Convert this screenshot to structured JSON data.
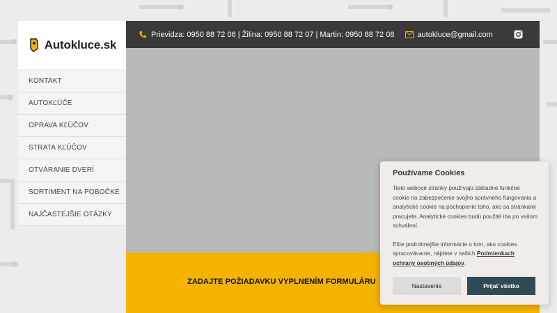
{
  "brand": {
    "name": "Autokluce.sk"
  },
  "nav": {
    "items": [
      {
        "label": "KONTAKT"
      },
      {
        "label": "AUTOKĽÚČE"
      },
      {
        "label": "OPRAVA KĽÚČOV"
      },
      {
        "label": "STRATA KĽÚČOV"
      },
      {
        "label": "OTVÁRANIE DVERÍ"
      },
      {
        "label": "SORTIMENT NA POBOČKE"
      },
      {
        "label": "NAJČASTEJŠIE OTÁZKY"
      }
    ]
  },
  "topbar": {
    "phones": "Prievidza: 0950 88 72 06 | Žilina: 0950 88 72 07 | Martin: 0950 88 72 08",
    "email": "autokluce@gmail.com",
    "phone_icon": "phone-icon",
    "mail_icon": "mail-icon",
    "social_icon": "instagram-icon"
  },
  "banner": {
    "text": "ZADAJTE POŽIADAVKU VYPLNENÍM FORMULÁRU"
  },
  "cookie": {
    "title": "Používame Cookies",
    "body1": "Tieto webové stránky používajú základné funkčné cookie na zabezpečenie svojho správneho fungovania a analytické cookie na pochopenie toho, ako sa stránkami pracujete. Analytické cookies budú použité iba po vašom schválení.",
    "body2_prefix": "Ešte podrobnejšie informácie o tom, ako cookies spracovávame, nájdete v našich ",
    "body2_link": "Podmienkach ochrany osobných údajov",
    "body2_suffix": ".",
    "settings_label": "Nastavenie",
    "accept_label": "Prijať všetko"
  },
  "colors": {
    "accent": "#f5b301",
    "topbar": "#3a3a3a",
    "accept_button": "#2f4b53"
  }
}
